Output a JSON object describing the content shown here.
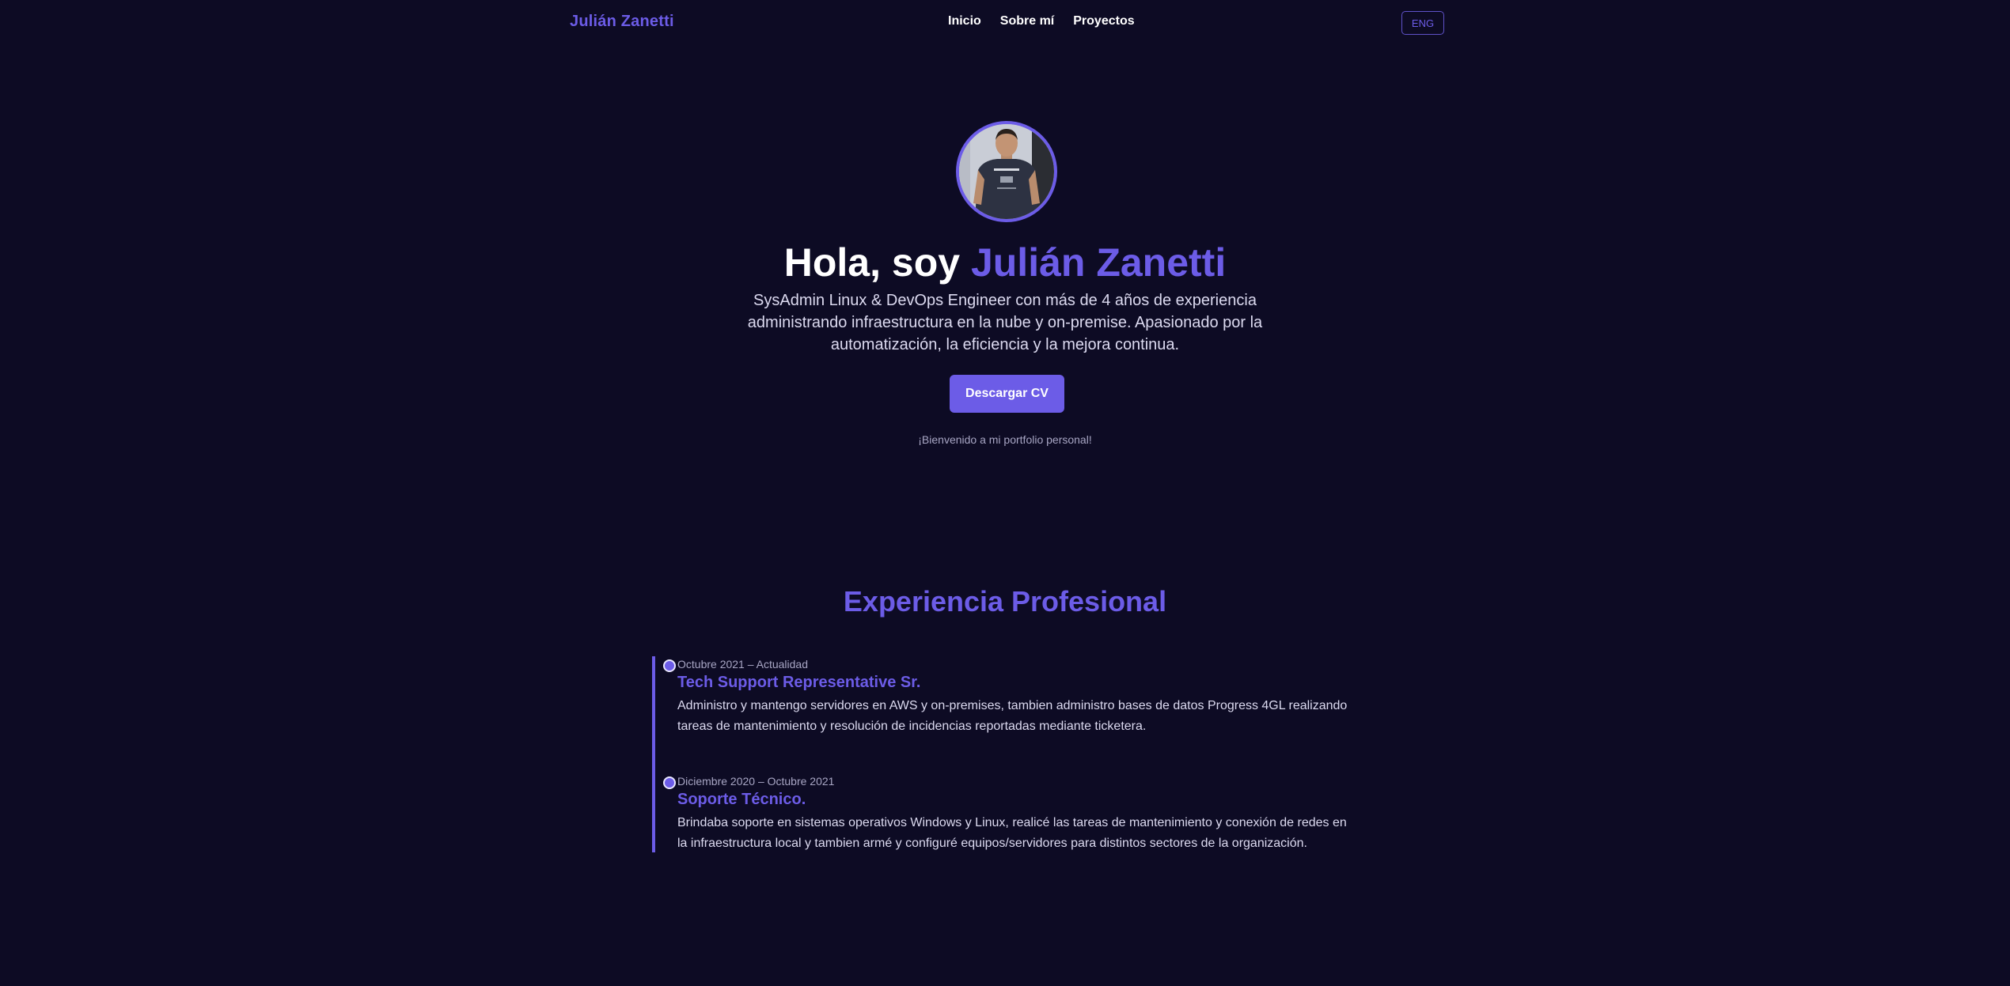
{
  "header": {
    "brand": "Julián Zanetti",
    "nav": [
      "Inicio",
      "Sobre mí",
      "Proyectos"
    ],
    "language_button": "ENG"
  },
  "hero": {
    "greeting": "Hola, soy ",
    "name": "Julián Zanetti",
    "description": "SysAdmin Linux & DevOps Engineer con más de 4 años de experiencia administrando infraestructura en la nube y on-premise. Apasionado por la automatización, la eficiencia y la mejora continua.",
    "cv_button": "Descargar CV",
    "welcome": "¡Bienvenido a mi portfolio personal!"
  },
  "experience": {
    "title": "Experiencia Profesional",
    "items": [
      {
        "date": "Octubre 2021 – Actualidad",
        "role": "Tech Support Representative Sr.",
        "text": "Administro y mantengo servidores en AWS y on-premises, tambien administro bases de datos Progress 4GL realizando tareas de mantenimiento y resolución de incidencias reportadas mediante ticketera."
      },
      {
        "date": "Diciembre 2020 – Octubre 2021",
        "role": "Soporte Técnico.",
        "text": "Brindaba soporte en sistemas operativos Windows y Linux, realicé las tareas de mantenimiento y conexión de redes en la infraestructura local y tambien armé y configuré equipos/servidores para distintos sectores de la organización."
      }
    ]
  },
  "colors": {
    "background": "#0d0b24",
    "accent": "#6c5ce7",
    "text": "#ffffff",
    "muted": "#a8a6c4"
  },
  "icons": {
    "timeline_marker": "timeline-dot-icon"
  }
}
